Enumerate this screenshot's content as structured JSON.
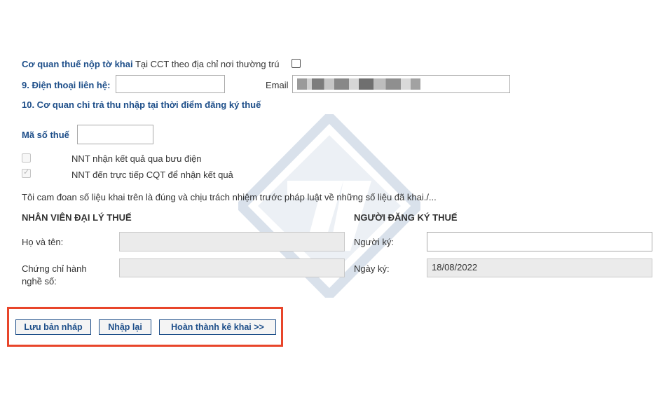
{
  "tax_office": {
    "label_bold": "Cơ quan thuế nộp tờ khai",
    "label_rest": "Tại CCT theo địa chỉ nơi thường trú",
    "checked": false
  },
  "phone": {
    "label": "9. Điện thoại liên hệ:",
    "value": ""
  },
  "email": {
    "label": "Email",
    "value": "redacted"
  },
  "section10": {
    "title": "10. Cơ quan chi trả thu nhập tại thời điểm đăng ký thuế"
  },
  "tax_code": {
    "label": "Mã số thuế",
    "value": ""
  },
  "options": [
    {
      "label": "NNT nhận kết quả qua bưu điện",
      "checked": false
    },
    {
      "label": "NNT đến trực tiếp CQT để nhận kết quả",
      "checked": true
    }
  ],
  "declaration": "Tôi cam đoan số liệu khai trên là đúng và chịu trách nhiệm trước pháp luật về những số liệu đã khai./...",
  "agent": {
    "title": "NHÂN VIÊN ĐẠI LÝ THUẾ",
    "name_label": "Họ và tên:",
    "cert_label": "Chứng chỉ hành nghề số:",
    "name_value": "",
    "cert_value": ""
  },
  "registrant": {
    "title": "NGƯỜI ĐĂNG KÝ THUẾ",
    "signer_label": "Người ký:",
    "date_label": "Ngày ký:",
    "signer_value": "",
    "date_value": "18/08/2022"
  },
  "buttons": {
    "save_draft": "Lưu bản nháp",
    "reset": "Nhập lại",
    "complete": "Hoàn thành kê khai >>"
  },
  "colors": {
    "label_blue": "#1d4e89",
    "highlight": "#e8452a",
    "disabled_bg": "#ebebeb"
  }
}
